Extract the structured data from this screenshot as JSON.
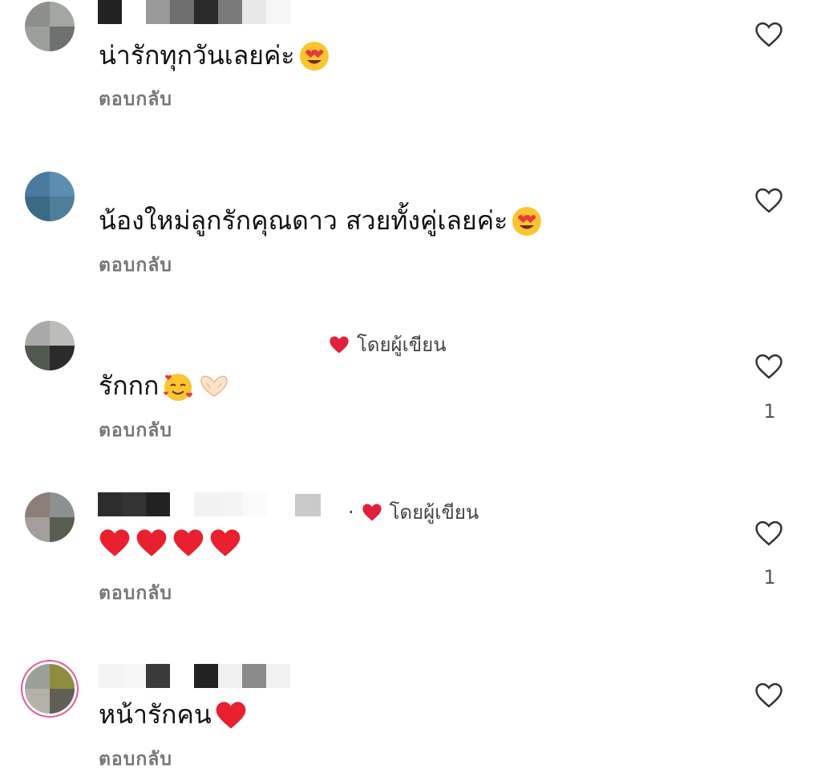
{
  "comments": [
    {
      "text": "น่ารักทุกวันเลยค่ะ",
      "emojis": [
        "heart-eyes-emoji"
      ],
      "reply": "ตอบกลับ",
      "likes": "",
      "author_liked": false
    },
    {
      "text": "น้องใหม่ลูกรักคุณดาว สวยทั้งคู่เลยค่ะ",
      "emojis": [
        "heart-eyes-emoji"
      ],
      "reply": "ตอบกลับ",
      "likes": "",
      "author_liked": false
    },
    {
      "text": "รักกก",
      "emojis": [
        "smiling-face-with-hearts-emoji",
        "heart-hands-emoji"
      ],
      "reply": "ตอบกลับ",
      "likes": "1",
      "author_liked": true,
      "author_like_label": "โดยผู้เขียน"
    },
    {
      "text": "",
      "emojis": [
        "red-heart-emoji",
        "red-heart-emoji",
        "red-heart-emoji",
        "red-heart-emoji"
      ],
      "reply": "ตอบกลับ",
      "likes": "1",
      "author_liked": true,
      "author_like_label": "โดยผู้เขียน"
    },
    {
      "text": "หน้ารักคน",
      "emojis": [
        "red-heart-emoji"
      ],
      "reply": "ตอบกลับ",
      "likes": "",
      "author_liked": false
    }
  ],
  "colors": {
    "accent_red": "#e0213c",
    "muted_text": "#777777",
    "icon_gray": "#333333"
  }
}
